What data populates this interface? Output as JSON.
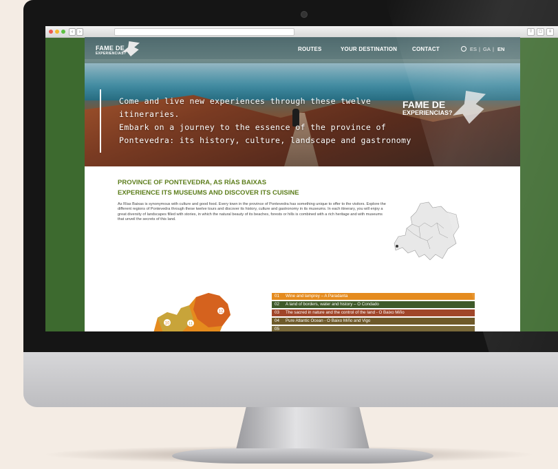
{
  "header": {
    "logo_main": "FAME DE",
    "logo_sub": "EXPERIENCIAS?",
    "nav": [
      "ROUTES",
      "YOUR DESTINATION",
      "CONTACT"
    ],
    "languages": [
      "ES",
      "GA",
      "EN"
    ],
    "active_language": "EN"
  },
  "hero": {
    "lines": [
      "Come and live new experiences through these twelve",
      "itineraries.",
      "Embark on a journey to the essence of the province of",
      "Pontevedra: its history, culture, landscape and gastronomy"
    ],
    "logo_main": "FAME DE",
    "logo_sub": "EXPERIENCIAS?"
  },
  "content": {
    "title_line1": "PROVINCE OF PONTEVEDRA, AS RÍAS BAIXAS",
    "title_line2": "EXPERIENCE ITS MUSEUMS AND DISCOVER ITS CUISINE",
    "body": "As Rías Baixas is synonymous with culture and good food. Every town in the province of Pontevedra has something unique to offer to the visitors. Explore the different regions of Pontevedra through these twelve tours and discover its history, culture and gastronomy in its museums. In each itinerary, you will enjoy a great diversity of landscapes filled with stories, in which the natural beauty of its beaches, forests or hills is combined with a rich heritage and with museums that unveil the secrets of this land."
  },
  "routes": [
    {
      "num": "01",
      "label": "Wine and lamprey – A Paradanta",
      "color": "#e58b1e"
    },
    {
      "num": "02",
      "label": "A land of borders, water and history – O Condado",
      "color": "#3f5a2a"
    },
    {
      "num": "03",
      "label": "The sacred in nature and the control of the land - O Baixo Miño",
      "color": "#a0462a"
    },
    {
      "num": "04",
      "label": "Pure Atlantic Ocean - O Baixo Miño and Vigo",
      "color": "#6e5a2a"
    },
    {
      "num": "05",
      "label": "",
      "color": "#7a6a3a"
    }
  ],
  "map_labels": [
    "10",
    "11",
    "12"
  ],
  "colors": {
    "accent_green": "#5c7d1b",
    "background_green": "#3d6a2f"
  }
}
